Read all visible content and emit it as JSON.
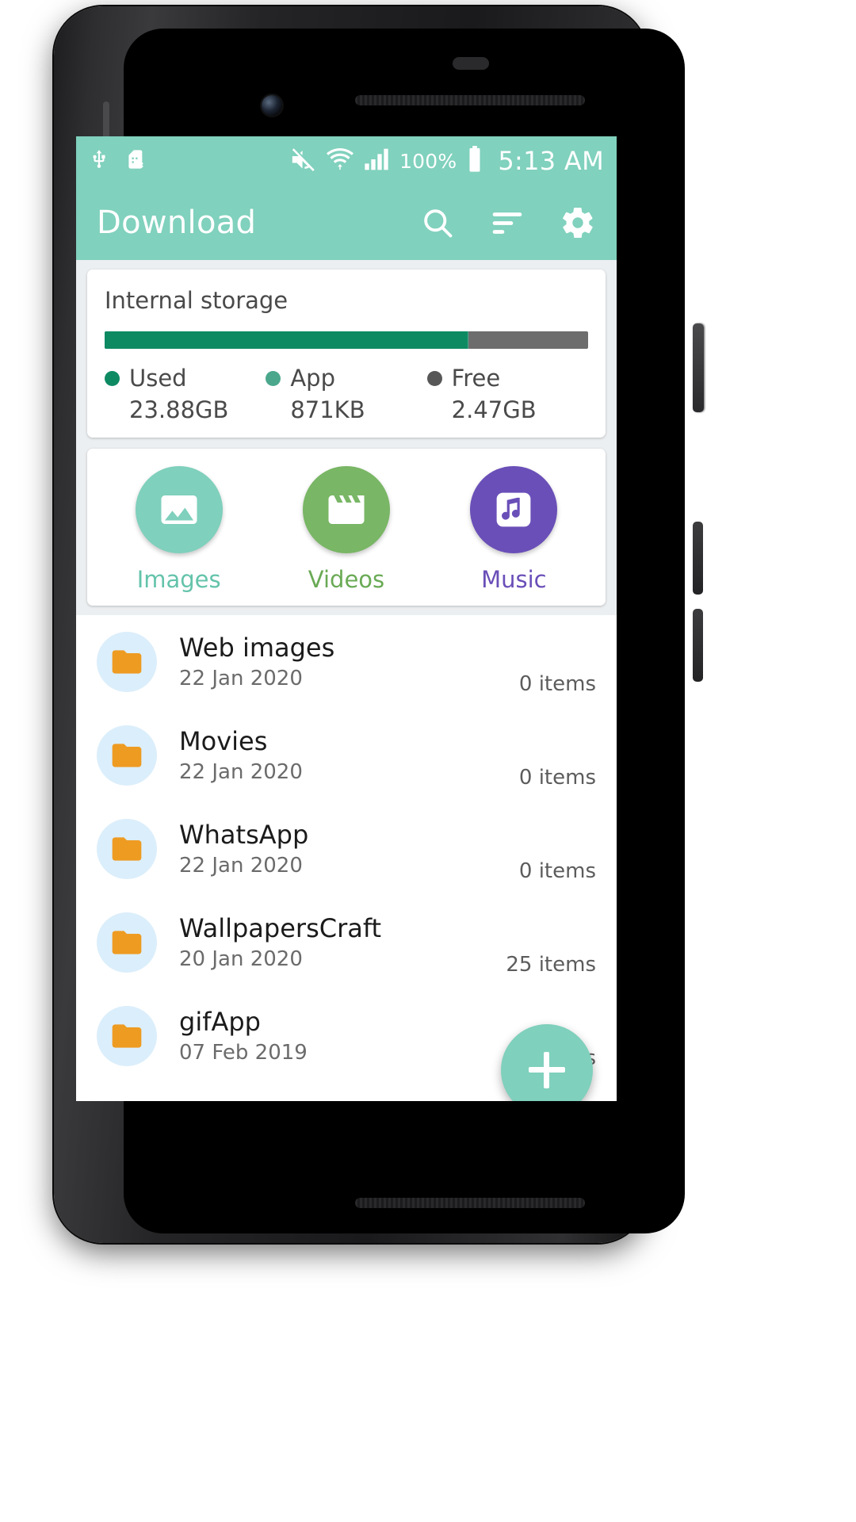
{
  "status_bar": {
    "icons_left": [
      "usb-icon",
      "sim-card-error-icon"
    ],
    "icons_right": [
      "mute-icon",
      "wifi-icon",
      "cellular-signal-icon"
    ],
    "battery_percent": "100%",
    "battery_icon": "battery-full-icon",
    "time": "5:13 AM"
  },
  "appbar": {
    "title": "Download",
    "actions": [
      {
        "name": "search-icon",
        "label": "Search"
      },
      {
        "name": "sort-icon",
        "label": "Sort"
      },
      {
        "name": "settings-gear-icon",
        "label": "Settings"
      }
    ]
  },
  "storage": {
    "title": "Internal storage",
    "bar": {
      "used_pct": 75,
      "app_pct": 0.1,
      "free_pct": 24.9
    },
    "colors": {
      "used": "#0e8a63",
      "app": "#4aa78c",
      "free": "#6d6d6d"
    },
    "legend": [
      {
        "label": "Used",
        "value": "23.88GB",
        "color": "#0e8a63"
      },
      {
        "label": "App",
        "value": "871KB",
        "color": "#4aa78c"
      },
      {
        "label": "Free",
        "value": "2.47GB",
        "color": "#575757"
      }
    ]
  },
  "categories": [
    {
      "label": "Images",
      "icon": "image-icon",
      "circle_color": "#7fd0bc",
      "label_color": "#64c3ab"
    },
    {
      "label": "Videos",
      "icon": "movie-clapper-icon",
      "circle_color": "#79b665",
      "label_color": "#6aaa55"
    },
    {
      "label": "Music",
      "icon": "music-note-icon",
      "circle_color": "#6a4fb8",
      "label_color": "#6a4fb8"
    }
  ],
  "files": [
    {
      "name": "Web images",
      "date": "22 Jan 2020",
      "count": "0 items",
      "icon": "folder-icon"
    },
    {
      "name": "Movies",
      "date": "22 Jan 2020",
      "count": "0 items",
      "icon": "folder-icon"
    },
    {
      "name": "WhatsApp",
      "date": "22 Jan 2020",
      "count": "0 items",
      "icon": "folder-icon"
    },
    {
      "name": "WallpapersCraft",
      "date": "20 Jan 2020",
      "count": "25 items",
      "icon": "folder-icon"
    },
    {
      "name": "gifApp",
      "date": "07 Feb 2019",
      "count": "62 items",
      "icon": "folder-icon"
    }
  ],
  "fab": {
    "label": "+",
    "name": "add-button",
    "color": "#7fd0bc"
  },
  "theme": {
    "accent": "#80d1bd",
    "folder": "#ee9b22",
    "folder_bg": "#dbeefb",
    "page_bg": "#eceff1"
  }
}
